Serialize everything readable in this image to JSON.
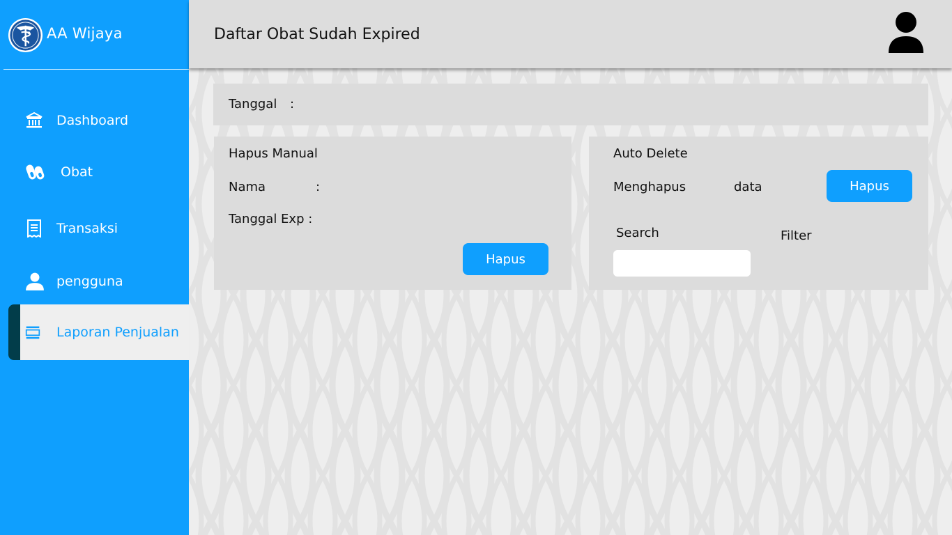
{
  "app": {
    "brand": "AA Wijaya",
    "accent_color": "#0f9ffe",
    "active_marker_color": "#023d4a"
  },
  "sidebar": {
    "items": [
      {
        "label": "Dashboard",
        "icon": "bank-icon"
      },
      {
        "label": "Obat",
        "icon": "pills-icon"
      },
      {
        "label": "Transaksi",
        "icon": "receipt-icon"
      },
      {
        "label": "pengguna",
        "icon": "user-icon"
      },
      {
        "label": "Laporan Penjualan",
        "icon": "report-icon",
        "active": true
      }
    ]
  },
  "header": {
    "title": "Daftar Obat Sudah Expired",
    "avatar_icon": "user-avatar-icon"
  },
  "date_bar": {
    "label": "Tanggal",
    "colon": ":"
  },
  "manual_delete": {
    "title": "Hapus Manual",
    "name_label": "Nama",
    "name_colon": ":",
    "exp_label": "Tanggal Exp :",
    "button": "Hapus"
  },
  "auto_delete": {
    "title": "Auto Delete",
    "delete_label": "Menghapus",
    "data_label": "data",
    "button": "Hapus",
    "search_label": "Search",
    "search_value": "",
    "filter_label": "Filter"
  }
}
